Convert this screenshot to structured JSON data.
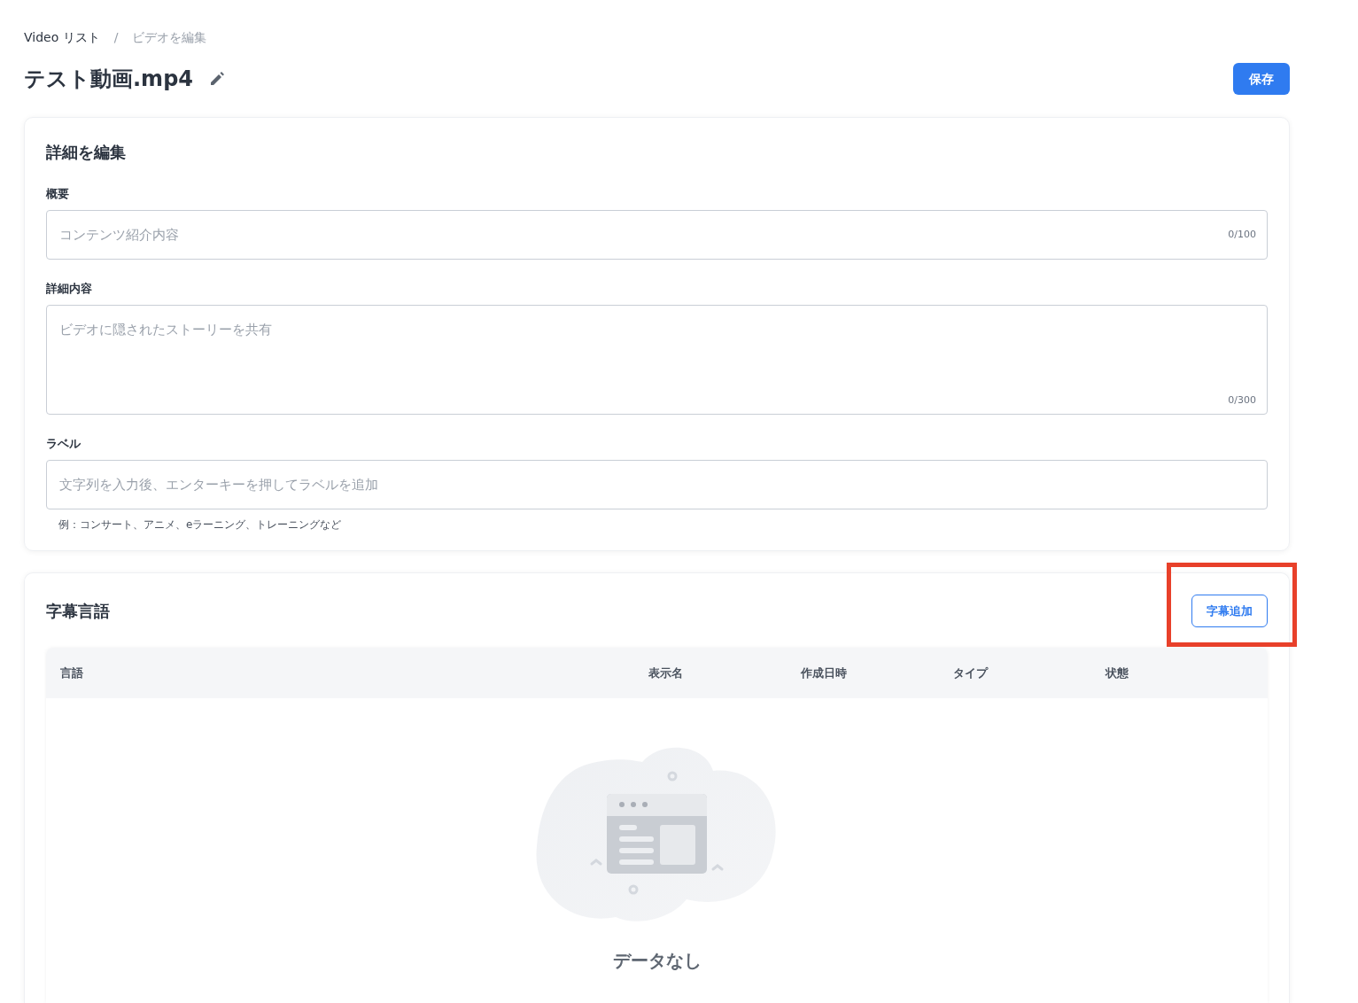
{
  "breadcrumb_separator": "/",
  "breadcrumb": [
    {
      "label": "Video リスト",
      "current": false
    },
    {
      "label": "ビデオを編集",
      "current": true
    }
  ],
  "title": "テスト動画.mp4",
  "save_button": "保存",
  "details": {
    "title": "詳細を編集",
    "fields": [
      {
        "kind": "input",
        "label": "概要",
        "placeholder": "コンテンツ紹介内容",
        "counter": "0/100"
      },
      {
        "kind": "textarea",
        "label": "詳細内容",
        "placeholder": "ビデオに隠されたストーリーを共有",
        "counter": "0/300"
      },
      {
        "kind": "input",
        "label": "ラベル",
        "placeholder": "文字列を入力後、エンターキーを押してラベルを追加",
        "hint": "例：コンサート、アニメ、eラーニング、トレーニングなど"
      }
    ]
  },
  "subtitles": {
    "title": "字幕言語",
    "add_button": {
      "label": "字幕追加",
      "highlighted": true
    },
    "columns": [
      "言語",
      "表示名",
      "作成日時",
      "タイプ",
      "状態"
    ],
    "empty_text": "データなし"
  }
}
